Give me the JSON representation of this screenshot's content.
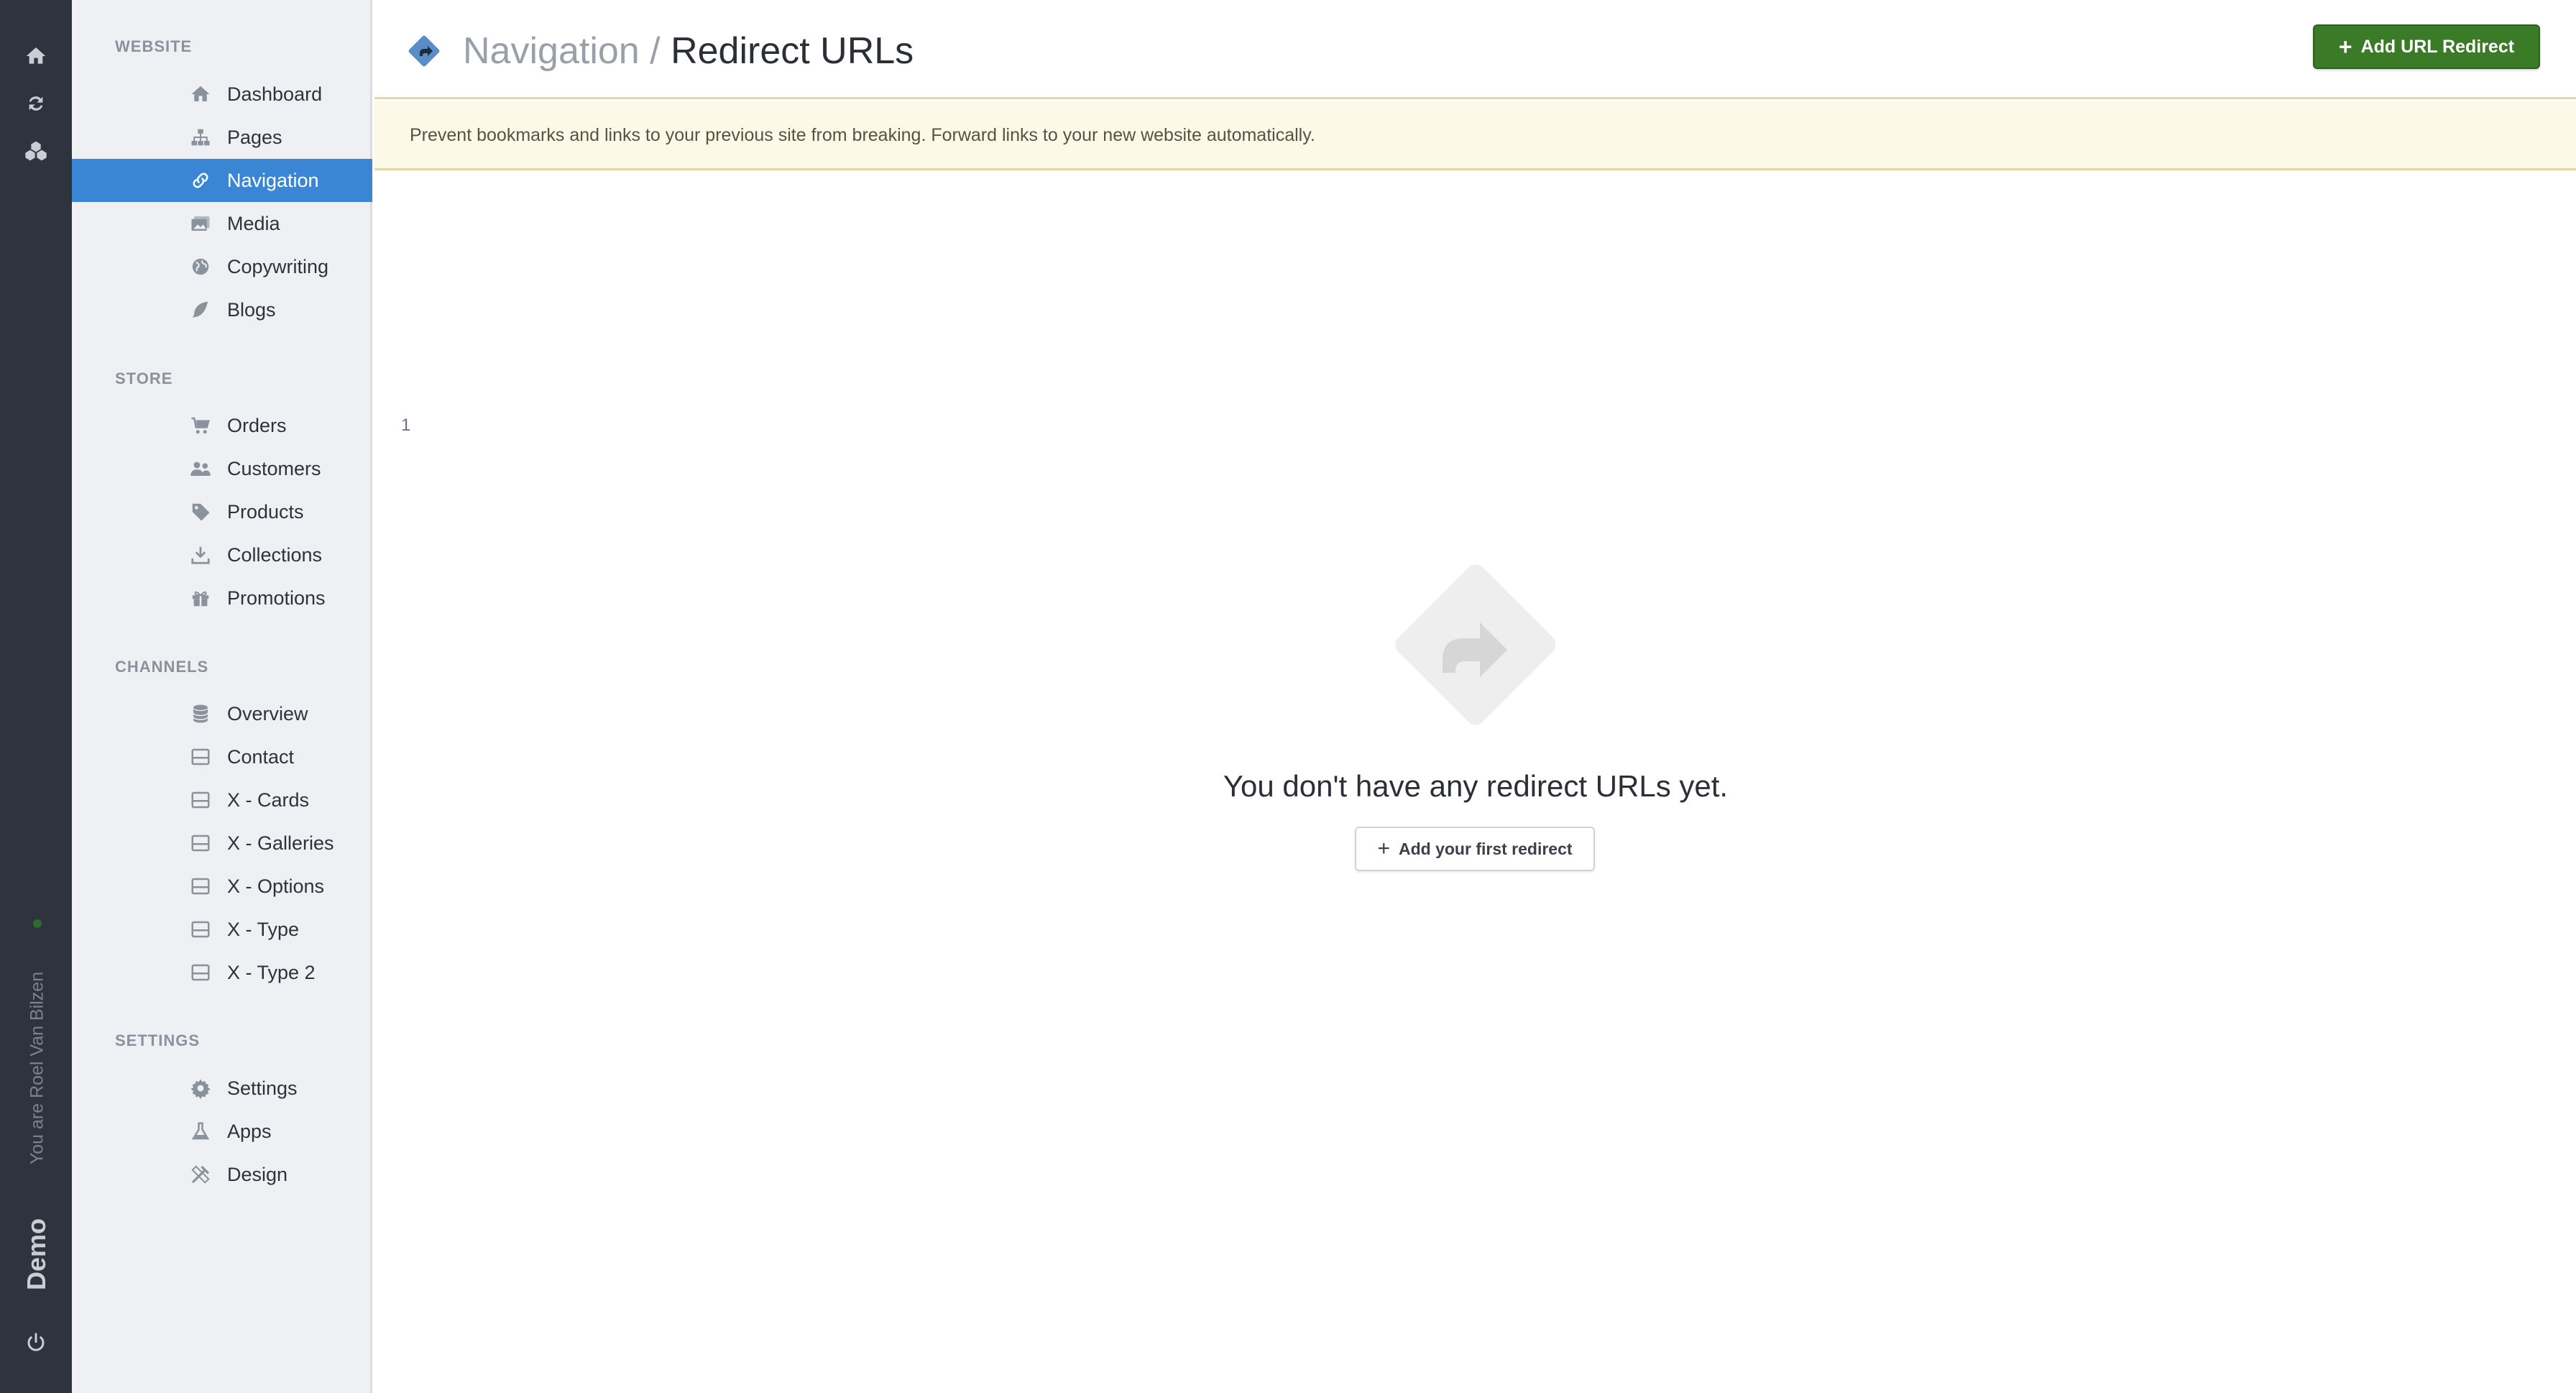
{
  "rail": {
    "items": [
      {
        "icon": "home-icon"
      },
      {
        "icon": "sync-icon"
      },
      {
        "icon": "cubes-icon"
      }
    ],
    "user_text": "You are Roel Van Bilzen",
    "store_name": "Demo",
    "status_color": "#2f6b2f"
  },
  "sidebar": {
    "sections": {
      "website": "WEBSITE",
      "store": "STORE",
      "channels": "CHANNELS",
      "settings": "SETTINGS"
    },
    "website_items": [
      {
        "label": "Dashboard",
        "icon": "home-icon"
      },
      {
        "label": "Pages",
        "icon": "sitemap-icon"
      },
      {
        "label": "Navigation",
        "icon": "link-icon"
      },
      {
        "label": "Media",
        "icon": "images-icon"
      },
      {
        "label": "Copywriting",
        "icon": "globe-icon"
      },
      {
        "label": "Blogs",
        "icon": "feather-icon"
      }
    ],
    "store_items": [
      {
        "label": "Orders",
        "icon": "cart-icon",
        "badge": "1"
      },
      {
        "label": "Customers",
        "icon": "users-icon"
      },
      {
        "label": "Products",
        "icon": "tags-icon"
      },
      {
        "label": "Collections",
        "icon": "download-icon"
      },
      {
        "label": "Promotions",
        "icon": "gift-icon"
      }
    ],
    "channel_items": [
      {
        "label": "Overview",
        "icon": "database-icon"
      },
      {
        "label": "Contact",
        "icon": "window-icon"
      },
      {
        "label": "X - Cards",
        "icon": "window-icon"
      },
      {
        "label": "X - Galleries",
        "icon": "window-icon"
      },
      {
        "label": "X - Options",
        "icon": "window-icon"
      },
      {
        "label": "X - Type",
        "icon": "window-icon"
      },
      {
        "label": "X - Type 2",
        "icon": "window-icon"
      }
    ],
    "settings_items": [
      {
        "label": "Settings",
        "icon": "gear-icon"
      },
      {
        "label": "Apps",
        "icon": "flask-icon"
      },
      {
        "label": "Design",
        "icon": "design-icon"
      }
    ],
    "active_item": "Navigation",
    "active_color": "#3a86d4"
  },
  "header": {
    "breadcrumb_parent": "Navigation",
    "separator": " / ",
    "title": "Redirect URLs",
    "add_button_label": "Add URL Redirect",
    "add_button_color": "#3b7a26"
  },
  "banner": {
    "text": "Prevent bookmarks and links to your previous site from breaking. Forward links to your new website automatically."
  },
  "empty_state": {
    "message": "You don't have any redirect URLs yet.",
    "button_label": "Add your first redirect"
  }
}
